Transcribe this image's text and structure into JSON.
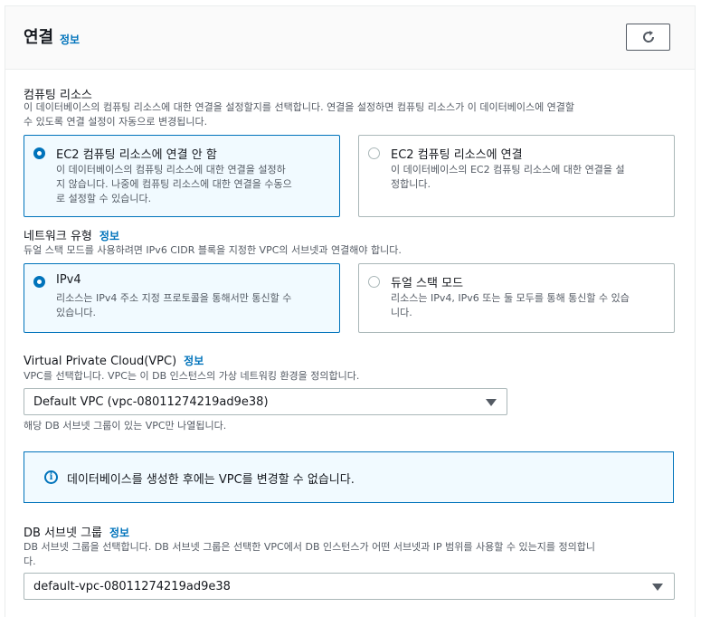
{
  "header": {
    "title": "연결",
    "info": "정보"
  },
  "compute": {
    "label": "컴퓨팅 리소스",
    "description_line1": "이 데이터베이스의 컴퓨팅 리소스에 대한 연결을 설정할지를 선택합니다. 연결을 설정하면 컴퓨팅 리소스가 이 데이터베이스에 연결할",
    "description_line2": "수 있도록 연결 설정이 자동으로 변경됩니다.",
    "options": [
      {
        "title": "EC2 컴퓨팅 리소스에 연결 안 함",
        "desc_line1": "이 데이터베이스의 컴퓨팅 리소스에 대한 연결을 설정하",
        "desc_line2": "지 않습니다. 나중에 컴퓨팅 리소스에 대한 연결을 수동으",
        "desc_line3": "로 설정할 수 있습니다.",
        "selected": true
      },
      {
        "title": "EC2 컴퓨팅 리소스에 연결",
        "desc_line1": "이 데이터베이스의 EC2 컴퓨팅 리소스에 대한 연결을 설",
        "desc_line2": "정합니다.",
        "selected": false
      }
    ]
  },
  "network": {
    "label": "네트워크 유형",
    "info": "정보",
    "description": "듀얼 스택 모드를 사용하려면 IPv6 CIDR 블록을 지정한 VPC의 서브넷과 연결해야 합니다.",
    "options": [
      {
        "title": "IPv4",
        "desc_line1": "리소스는 IPv4 주소 지정 프로토콜을 통해서만 통신할 수",
        "desc_line2": "있습니다.",
        "selected": true
      },
      {
        "title": "듀얼 스택 모드",
        "desc_line1": "리소스는 IPv4, IPv6 또는 둘 모두를 통해 통신할 수 있습",
        "desc_line2": "니다.",
        "selected": false
      }
    ]
  },
  "vpc": {
    "label": "Virtual Private Cloud(VPC)",
    "info": "정보",
    "description": "VPC를 선택합니다. VPC는 이 DB 인스턴스의 가상 네트워킹 환경을 정의합니다.",
    "selected": "Default VPC (vpc-08011274219ad9e38)",
    "hint": "해당 DB 서브넷 그룹이 있는 VPC만 나열됩니다."
  },
  "alert": {
    "icon": "info-icon",
    "text": "데이터베이스를 생성한 후에는 VPC를 변경할 수 없습니다."
  },
  "subnet": {
    "label": "DB 서브넷 그룹",
    "info": "정보",
    "description": "DB 서브넷 그룹을 선택합니다. DB 서브넷 그룹은 선택한 VPC에서 DB 인스턴스가 어떤 서브넷과 IP 범위를 사용할 수 있는지를 정의합니",
    "description_line2": "다.",
    "selected": "default-vpc-08011274219ad9e38"
  }
}
